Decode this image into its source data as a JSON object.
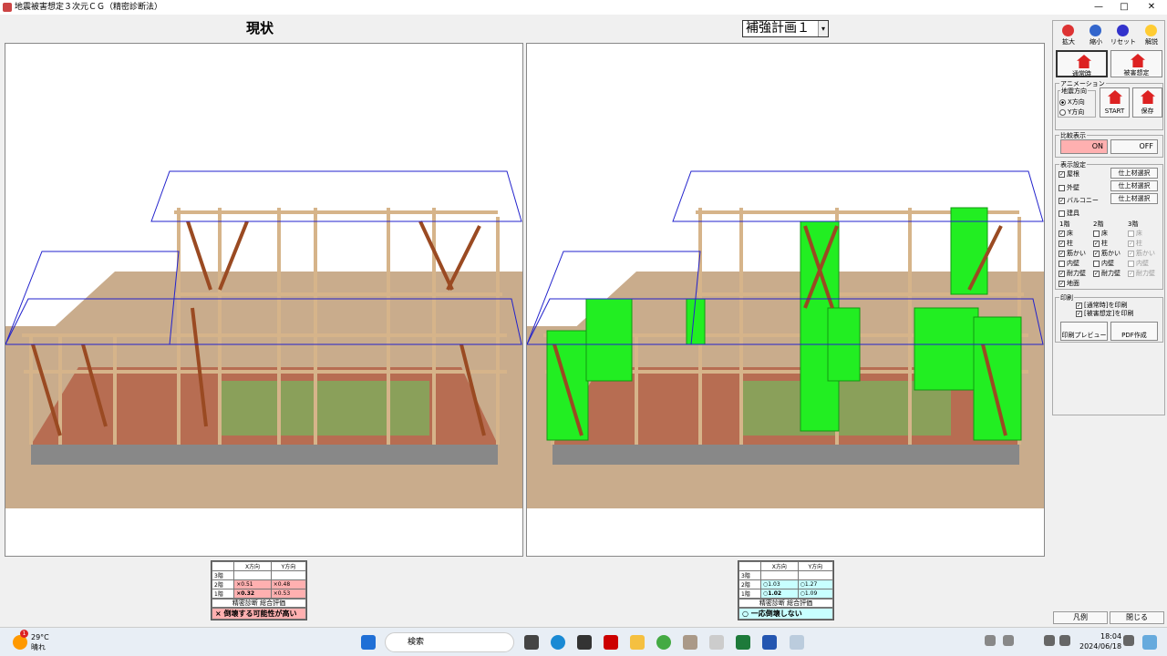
{
  "window": {
    "title": "地震被害想定３次元ＣＧ（精密診断法）",
    "min": "—",
    "max": "□",
    "close": "✕"
  },
  "captions": {
    "left": "現状",
    "plan_value": "補強計画１",
    "plan_arrow": "▾"
  },
  "left_eval": {
    "col_x": "X方向",
    "col_y": "Y方向",
    "rows": [
      {
        "floor": "3階",
        "x": "",
        "y": ""
      },
      {
        "floor": "2階",
        "x": "×0.51",
        "y": "×0.48"
      },
      {
        "floor": "1階",
        "x": "×0.32",
        "y": "×0.53"
      }
    ],
    "overall_label": "精密診断 総合評価",
    "overall": "× 倒壊する可能性が高い"
  },
  "right_eval": {
    "col_x": "X方向",
    "col_y": "Y方向",
    "rows": [
      {
        "floor": "3階",
        "x": "",
        "y": ""
      },
      {
        "floor": "2階",
        "x": "○1.03",
        "y": "○1.27"
      },
      {
        "floor": "1階",
        "x": "○1.02",
        "y": "○1.09"
      }
    ],
    "overall_label": "精密診断 総合評価",
    "overall": "○ 一応倒壊しない"
  },
  "toolbar": {
    "zoom_in": "拡大",
    "zoom_out": "縮小",
    "reset": "リセット",
    "help": "解説",
    "normal": "通常時",
    "damage": "被害想定"
  },
  "animation": {
    "label": "アニメーション",
    "direction_label": "地震方向",
    "x_dir": "X方向",
    "y_dir": "Y方向",
    "start": "START",
    "save": "保存"
  },
  "compare": {
    "label": "比較表示",
    "on": "ON",
    "off": "OFF"
  },
  "display": {
    "label": "表示設定",
    "roof": "屋根",
    "outer_wall": "外壁",
    "balcony": "バルコニー",
    "fixture": "建具",
    "finish_btn": "仕上材選択",
    "f1": "1階",
    "f2": "2階",
    "f3": "3階",
    "floor": "床",
    "column": "柱",
    "brace": "筋かい",
    "inner_wall": "内壁",
    "bearing_wall": "耐力壁",
    "ground": "地面"
  },
  "print": {
    "label": "印刷",
    "normal_print": "[通常時]を印刷",
    "damage_print": "[被害想定]を印刷",
    "preview": "印刷プレビュー",
    "pdf": "PDF作成"
  },
  "bottom": {
    "legend": "凡例",
    "close": "閉じる"
  },
  "taskbar": {
    "temp": "29°C",
    "weather": "晴れ",
    "search": "検索",
    "time": "18:04",
    "date": "2024/06/18",
    "badge": "1"
  },
  "colors": {
    "bad": "#ffb0b0",
    "good": "#c8ffff",
    "brace": "#9a4a22",
    "wood": "#e8c9a0",
    "roof": "#2222cc",
    "wall": "#22ee22"
  }
}
